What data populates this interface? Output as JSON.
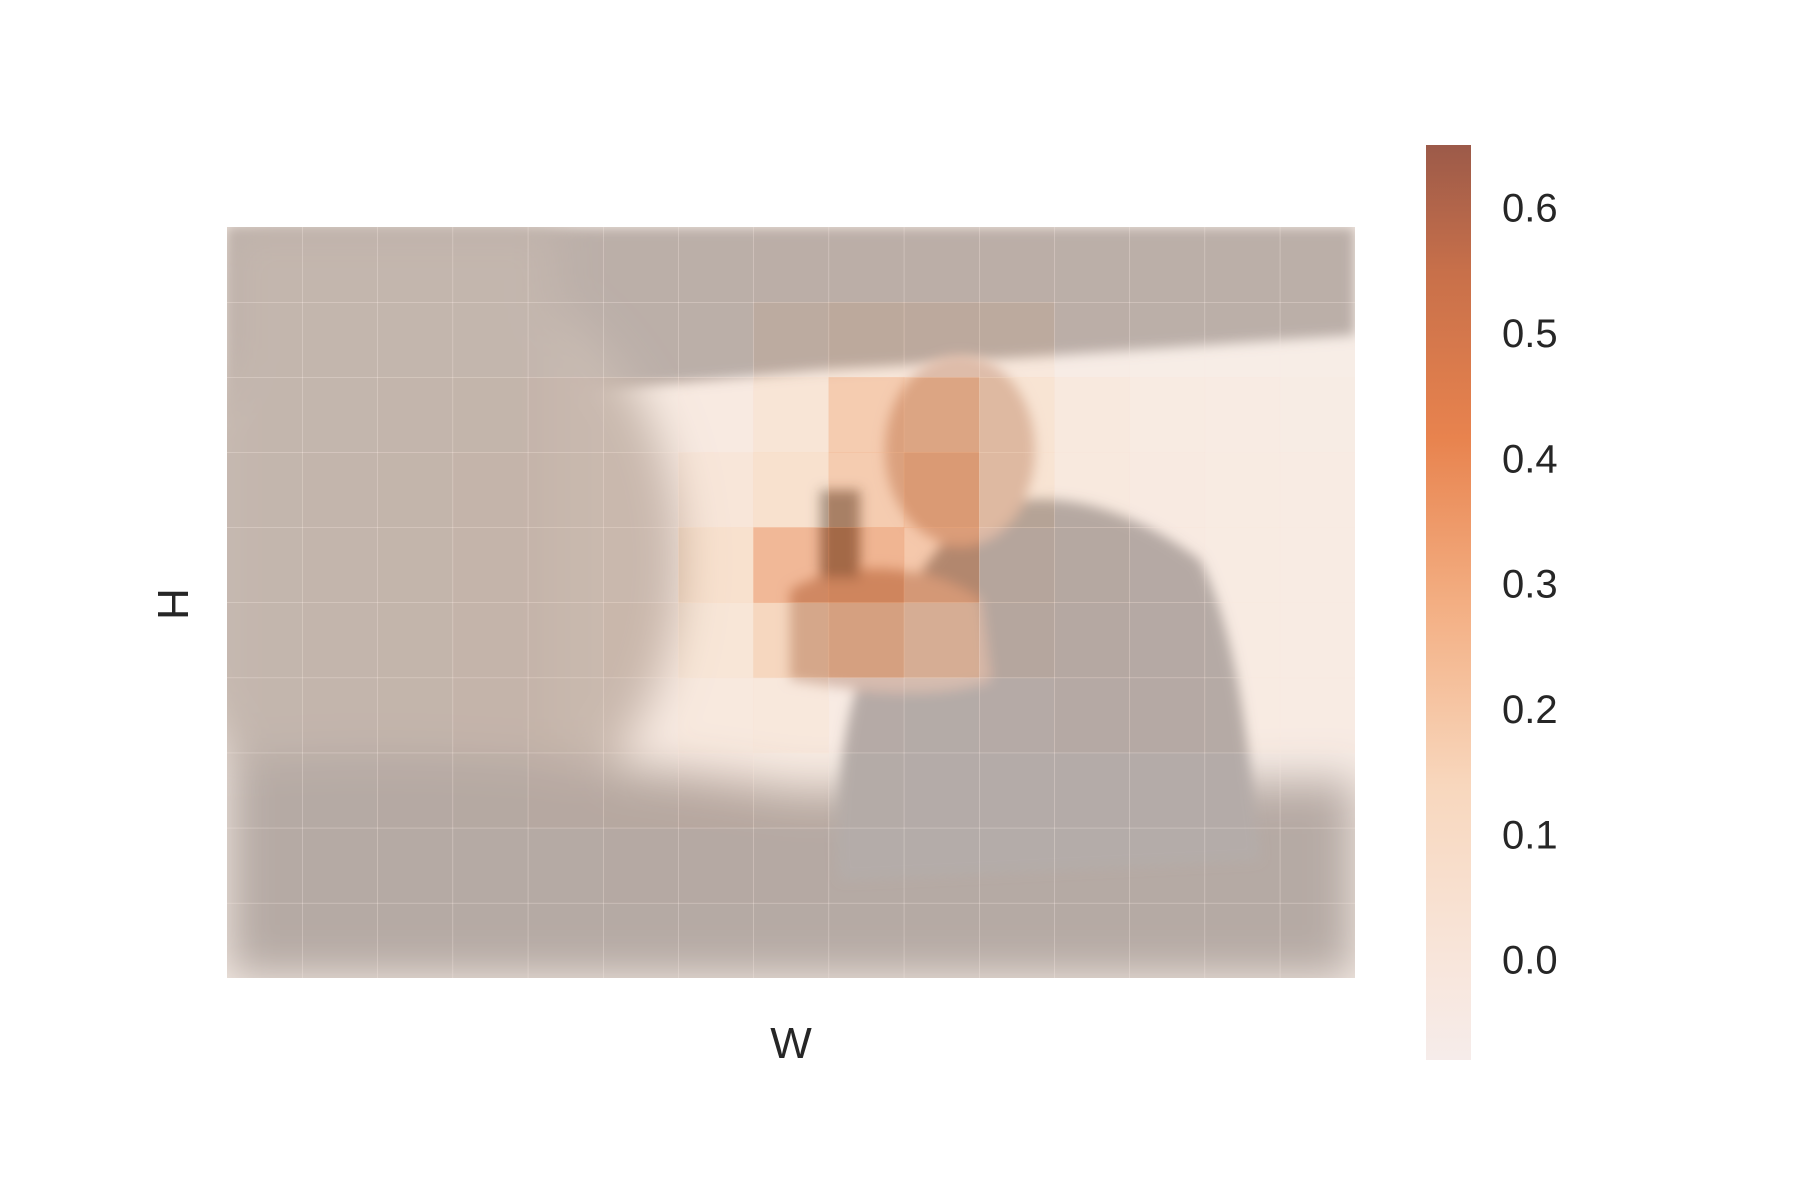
{
  "chart_data": {
    "type": "heatmap",
    "title": "",
    "xlabel": "W",
    "ylabel": "H",
    "grid": false,
    "background_image": "blurred photo of a man in a leather jacket aiming a handgun, seen past a blurred person in the foreground, bright sky behind",
    "colormap": {
      "name": "light-to-dark orange-brown",
      "stops": [
        "#f6ecea",
        "#f8e0cf",
        "#f2b98f",
        "#e8834e",
        "#c8704a",
        "#9c5a49"
      ]
    },
    "colorbar": {
      "ticks": [
        0.0,
        0.1,
        0.2,
        0.3,
        0.4,
        0.5,
        0.6
      ],
      "tick_labels": [
        "0.0",
        "0.1",
        "0.2",
        "0.3",
        "0.4",
        "0.5",
        "0.6"
      ],
      "range": [
        -0.08,
        0.65
      ],
      "location": "right"
    },
    "grid_size": {
      "rows": 10,
      "cols": 15
    },
    "cell_values": [
      [
        -0.05,
        -0.05,
        -0.05,
        -0.05,
        -0.05,
        -0.05,
        -0.05,
        -0.04,
        -0.04,
        -0.04,
        -0.04,
        -0.05,
        -0.05,
        -0.05,
        -0.05
      ],
      [
        -0.05,
        -0.05,
        -0.05,
        -0.05,
        -0.05,
        -0.05,
        -0.05,
        0.02,
        0.05,
        0.04,
        0.03,
        -0.04,
        -0.05,
        -0.05,
        -0.05
      ],
      [
        -0.05,
        -0.05,
        -0.04,
        -0.03,
        -0.02,
        -0.01,
        0.0,
        0.08,
        0.26,
        0.24,
        0.1,
        0.02,
        -0.01,
        -0.02,
        -0.03
      ],
      [
        -0.05,
        -0.04,
        -0.03,
        -0.02,
        -0.01,
        0.0,
        0.06,
        0.14,
        0.26,
        0.3,
        0.1,
        0.02,
        0.0,
        -0.01,
        -0.02
      ],
      [
        -0.05,
        -0.04,
        -0.03,
        -0.02,
        -0.01,
        0.0,
        0.14,
        0.36,
        0.38,
        0.28,
        0.06,
        0.02,
        0.0,
        -0.01,
        -0.02
      ],
      [
        -0.05,
        -0.04,
        -0.03,
        -0.02,
        -0.01,
        0.01,
        0.07,
        0.2,
        0.24,
        0.16,
        0.04,
        0.01,
        0.0,
        -0.01,
        -0.02
      ],
      [
        -0.05,
        -0.04,
        -0.03,
        -0.02,
        -0.01,
        0.0,
        0.02,
        0.03,
        -0.02,
        -0.03,
        -0.02,
        0.0,
        0.0,
        -0.01,
        -0.02
      ],
      [
        -0.05,
        -0.05,
        -0.04,
        -0.03,
        -0.02,
        -0.01,
        0.0,
        -0.01,
        -0.03,
        -0.04,
        -0.04,
        -0.04,
        -0.04,
        -0.04,
        -0.04
      ],
      [
        -0.05,
        -0.05,
        -0.05,
        -0.05,
        -0.05,
        -0.04,
        -0.04,
        -0.04,
        -0.05,
        -0.05,
        -0.05,
        -0.05,
        -0.05,
        -0.05,
        -0.05
      ],
      [
        -0.05,
        -0.05,
        -0.05,
        -0.05,
        -0.05,
        -0.05,
        -0.05,
        -0.05,
        -0.05,
        -0.05,
        -0.05,
        -0.05,
        -0.05,
        -0.05,
        -0.05
      ]
    ]
  }
}
